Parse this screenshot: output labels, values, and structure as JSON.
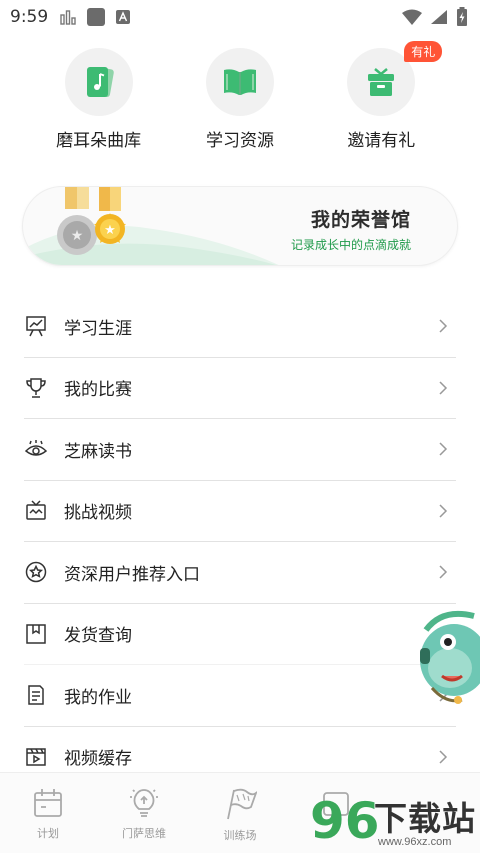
{
  "status_bar": {
    "time": "9:59",
    "left_icons": [
      "signal-bars-icon",
      "square-icon",
      "a-notification-icon"
    ],
    "right_icons": [
      "wifi-icon",
      "cell-signal-icon",
      "battery-charging-icon"
    ]
  },
  "features": [
    {
      "label": "磨耳朵曲库",
      "icon": "music-card-icon"
    },
    {
      "label": "学习资源",
      "icon": "open-book-icon"
    },
    {
      "label": "邀请有礼",
      "icon": "gift-icon",
      "badge": "有礼"
    }
  ],
  "banner": {
    "title": "我的荣誉馆",
    "subtitle": "记录成长中的点滴成就",
    "accent_color": "#1f9a4a"
  },
  "menu": [
    {
      "label": "学习生涯",
      "icon": "presentation-board-icon"
    },
    {
      "label": "我的比赛",
      "icon": "trophy-icon"
    },
    {
      "label": "芝麻读书",
      "icon": "reading-eye-icon"
    },
    {
      "label": "挑战视频",
      "icon": "tv-icon"
    },
    {
      "label": "资深用户推荐入口",
      "icon": "star-circle-icon"
    },
    {
      "label": "发货查询",
      "icon": "package-box-icon"
    },
    {
      "label": "我的作业",
      "icon": "document-list-icon"
    },
    {
      "label": "视频缓存",
      "icon": "film-play-icon"
    }
  ],
  "bottom_nav": [
    {
      "label": "计划",
      "icon": "calendar-icon"
    },
    {
      "label": "门萨思维",
      "icon": "lightbulb-icon"
    },
    {
      "label": "训练场",
      "icon": "flag-icon"
    }
  ],
  "watermark": {
    "number": "96",
    "text": "下载站",
    "url": "www.96xz.com"
  },
  "colors": {
    "brand_green": "#3dbb73",
    "badge_red": "#ff5436"
  }
}
